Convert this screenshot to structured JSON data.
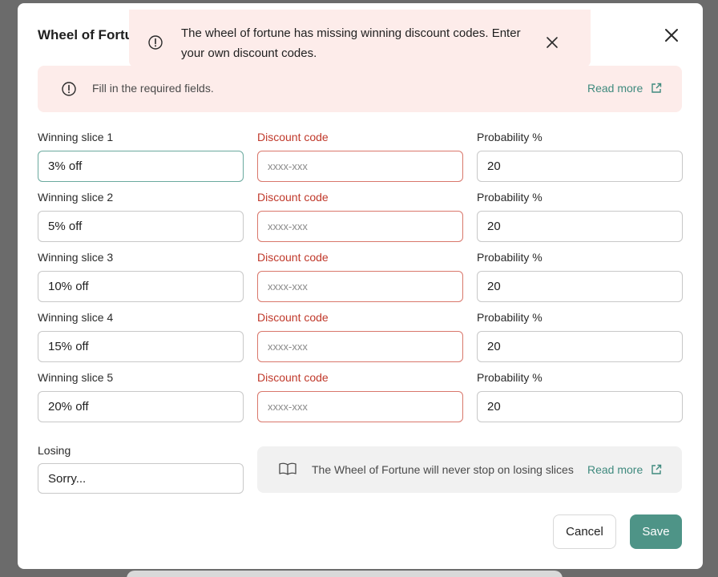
{
  "modal": {
    "title": "Wheel of Fortune",
    "alert": {
      "text": "Fill in the required fields.",
      "read_more": "Read more"
    },
    "slices": [
      {
        "slice_label": "Winning slice 1",
        "slice_value": "3% off",
        "code_label": "Discount code",
        "code_placeholder": "xxxx-xxx",
        "prob_label": "Probability %",
        "prob_value": "20"
      },
      {
        "slice_label": "Winning slice 2",
        "slice_value": "5% off",
        "code_label": "Discount code",
        "code_placeholder": "xxxx-xxx",
        "prob_label": "Probability %",
        "prob_value": "20"
      },
      {
        "slice_label": "Winning slice 3",
        "slice_value": "10% off",
        "code_label": "Discount code",
        "code_placeholder": "xxxx-xxx",
        "prob_label": "Probability %",
        "prob_value": "20"
      },
      {
        "slice_label": "Winning slice 4",
        "slice_value": "15% off",
        "code_label": "Discount code",
        "code_placeholder": "xxxx-xxx",
        "prob_label": "Probability %",
        "prob_value": "20"
      },
      {
        "slice_label": "Winning slice 5",
        "slice_value": "20% off",
        "code_label": "Discount code",
        "code_placeholder": "xxxx-xxx",
        "prob_label": "Probability %",
        "prob_value": "20"
      }
    ],
    "losing": {
      "label": "Losing",
      "value": "Sorry..."
    },
    "info_box": {
      "text": "The Wheel of Fortune will never stop on losing slices",
      "read_more": "Read more"
    },
    "buttons": {
      "cancel": "Cancel",
      "save": "Save"
    }
  },
  "toast": {
    "text": "The wheel of fortune has missing winning discount codes. Enter your own discount codes."
  },
  "colors": {
    "accent": "#4e9487",
    "link": "#3f8a7e",
    "error": "#c0392b",
    "error_border": "#d9776b",
    "alert_bg": "#fdecea",
    "info_bg": "#f1f1f1"
  }
}
